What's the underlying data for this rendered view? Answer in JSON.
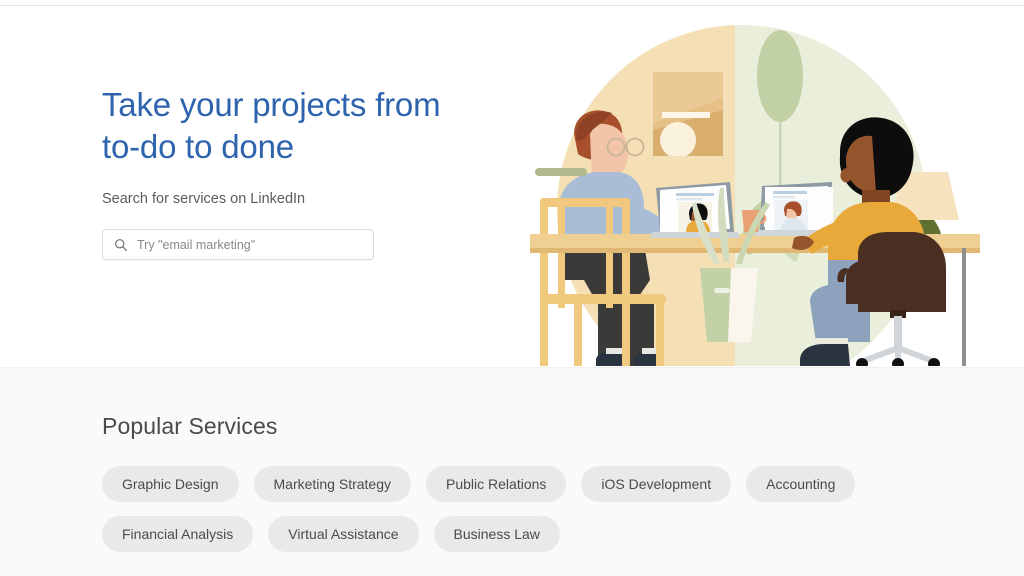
{
  "hero": {
    "headline": "Take your projects from\nto-do to done",
    "subhead": "Search for services on LinkedIn",
    "search": {
      "placeholder": "Try \"email marketing\"",
      "value": "",
      "icon": "search-icon"
    },
    "headline_color": "#2e64ad",
    "background_color": "#ffffff"
  },
  "illustration": {
    "alt": "Two colleagues at a shared desk on a video call with each other",
    "colors": {
      "circle_left": "#f5dfb4",
      "circle_right": "#e9efdb",
      "desk": "#efc87f",
      "chair_wood": "#f0c87e",
      "office_chair": "#4a2f22",
      "person_left_top": "#a9bed6",
      "person_left_pants": "#3a3a38",
      "person_left_hair": "#a8502c",
      "person_left_skin": "#f3c5a8",
      "person_right_top": "#e8a93a",
      "person_right_pants": "#8da3bd",
      "person_right_hair": "#0d0d0d",
      "person_right_skin": "#96542c",
      "plant_leaf": "#c3d1a6",
      "lamp_shade": "#f6e2bc",
      "lamp_base": "#5f7031",
      "frame": "#f5e3c0"
    }
  },
  "services": {
    "title": "Popular Services",
    "background_color": "#fafafa",
    "chip_color": "#e9e9e9",
    "rows": [
      [
        {
          "label": "Graphic Design"
        },
        {
          "label": "Marketing Strategy"
        },
        {
          "label": "Public Relations"
        },
        {
          "label": "iOS Development"
        },
        {
          "label": "Accounting"
        }
      ],
      [
        {
          "label": "Financial Analysis"
        },
        {
          "label": "Virtual Assistance"
        },
        {
          "label": "Business Law"
        }
      ]
    ]
  }
}
